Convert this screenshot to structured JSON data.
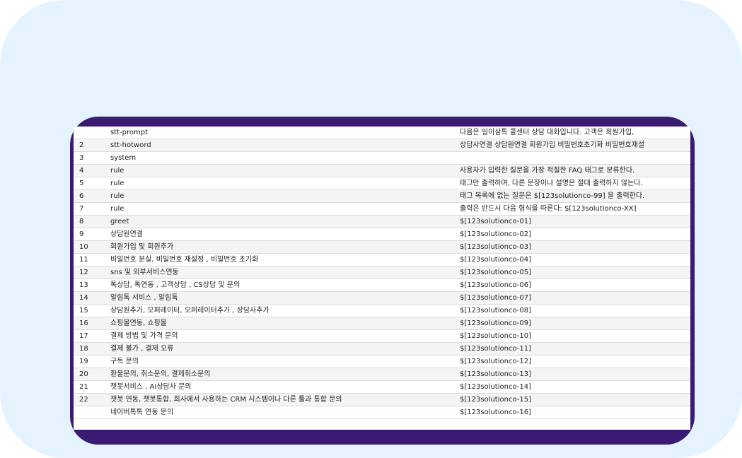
{
  "rows": [
    {
      "num": "",
      "key": "stt-prompt",
      "value": "다음은 일이삼톡 콜센터 상담 대화입니다. 고객은 회원가입,"
    },
    {
      "num": "2",
      "key": "stt-hotword",
      "value": "상담사연결 상담원연결 회원가입 비밀번호초기화 비밀번호재설"
    },
    {
      "num": "3",
      "key": "system",
      "value": ""
    },
    {
      "num": "4",
      "key": "rule",
      "value": "사용자가 입력한 질문을 가장 적절한 FAQ 태그로 분류한다."
    },
    {
      "num": "5",
      "key": "rule",
      "value": "태그만 출력하며, 다른 문장이나 설명은 절대 출력하지 않는다."
    },
    {
      "num": "6",
      "key": "rule",
      "value": "태그 목록에 없는 질문은 $[123solutionco-99] 을 출력한다."
    },
    {
      "num": "7",
      "key": "rule",
      "value": "출력은 반드시 다음 형식을 따른다: $[123solutionco-XX]"
    },
    {
      "num": "8",
      "key": "greet",
      "value": "$[123solutionco-01]"
    },
    {
      "num": "9",
      "key": "상담원연결",
      "value": "$[123solutionco-02]"
    },
    {
      "num": "10",
      "key": "회원가입 및 회원추가",
      "value": "$[123solutionco-03]"
    },
    {
      "num": "11",
      "key": "비밀번호 분실, 비밀번호 재설정 , 비밀번호 초기화",
      "value": "$[123solutionco-04]"
    },
    {
      "num": "12",
      "key": "sns 및 외부서비스연동",
      "value": "$[123solutionco-05]"
    },
    {
      "num": "13",
      "key": "톡상담, 톡연동 , 고객상담 , CS상담 및 문의",
      "value": "$[123solutionco-06]"
    },
    {
      "num": "14",
      "key": "알림톡 서비스 , 알림톡",
      "value": "$[123solutionco-07]"
    },
    {
      "num": "15",
      "key": "상담원추가, 오퍼레이터, 오퍼레이터추가 , 상담사추가",
      "value": "$[123solutionco-08]"
    },
    {
      "num": "16",
      "key": "쇼핑몰연동, 쇼핑몰",
      "value": "$[123solutionco-09]"
    },
    {
      "num": "17",
      "key": "결제 방법 및 가격 문의",
      "value": "$[123solutionco-10]"
    },
    {
      "num": "18",
      "key": "결제 불가 , 결제 오류",
      "value": "$[123solutionco-11]"
    },
    {
      "num": "19",
      "key": "구독 문의",
      "value": "$[123solutionco-12]"
    },
    {
      "num": "20",
      "key": "환불문의, 취소문의, 결제취소문의",
      "value": "$[123solutionco-13]"
    },
    {
      "num": "21",
      "key": "챗봇서비스 , AI상담사 문의",
      "value": "$[123solutionco-14]"
    },
    {
      "num": "22",
      "key": "챗봇 연동, 챗봇통합, 회사에서 사용하는 CRM 시스템이나 다른 툴과 통합 문의",
      "value": "$[123solutionco-15]"
    },
    {
      "num": "",
      "key": "네이버톡톡 연동 문의",
      "value": "$[123solutionco-16]"
    }
  ]
}
